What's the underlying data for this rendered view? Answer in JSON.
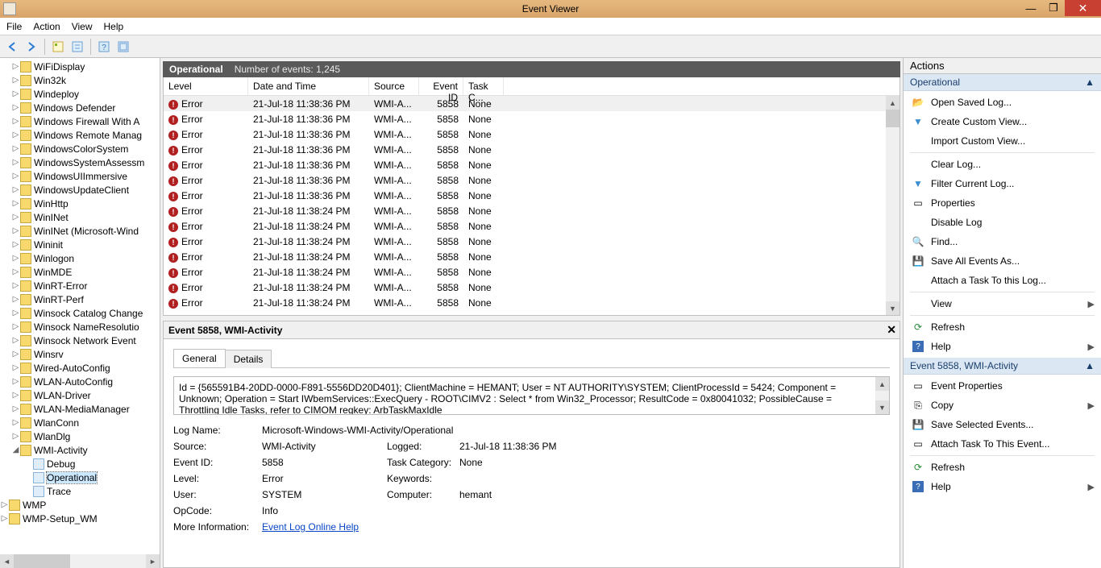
{
  "window": {
    "title": "Event Viewer"
  },
  "menu": {
    "file": "File",
    "action": "Action",
    "view": "View",
    "help": "Help"
  },
  "tree": {
    "items": [
      "WiFiDisplay",
      "Win32k",
      "Windeploy",
      "Windows Defender",
      "Windows Firewall With A",
      "Windows Remote Manag",
      "WindowsColorSystem",
      "WindowsSystemAssessm",
      "WindowsUIImmersive",
      "WindowsUpdateClient",
      "WinHttp",
      "WinINet",
      "WinINet (Microsoft-Wind",
      "Wininit",
      "Winlogon",
      "WinMDE",
      "WinRT-Error",
      "WinRT-Perf",
      "Winsock Catalog Change",
      "Winsock NameResolutio",
      "Winsock Network Event",
      "Winsrv",
      "Wired-AutoConfig",
      "WLAN-AutoConfig",
      "WLAN-Driver",
      "WLAN-MediaManager",
      "WlanConn",
      "WlanDlg"
    ],
    "wmi": {
      "label": "WMI-Activity",
      "children": [
        "Debug",
        "Operational",
        "Trace"
      ]
    },
    "after": [
      "WMP",
      "WMP-Setup_WM"
    ],
    "selected": "Operational"
  },
  "listHeader": {
    "title": "Operational",
    "count": "Number of events: 1,245"
  },
  "columns": {
    "level": "Level",
    "date": "Date and Time",
    "source": "Source",
    "eid": "Event ID",
    "task": "Task C..."
  },
  "rows": [
    {
      "level": "Error",
      "date": "21-Jul-18 11:38:36 PM",
      "source": "WMI-A...",
      "eid": "5858",
      "task": "None"
    },
    {
      "level": "Error",
      "date": "21-Jul-18 11:38:36 PM",
      "source": "WMI-A...",
      "eid": "5858",
      "task": "None"
    },
    {
      "level": "Error",
      "date": "21-Jul-18 11:38:36 PM",
      "source": "WMI-A...",
      "eid": "5858",
      "task": "None"
    },
    {
      "level": "Error",
      "date": "21-Jul-18 11:38:36 PM",
      "source": "WMI-A...",
      "eid": "5858",
      "task": "None"
    },
    {
      "level": "Error",
      "date": "21-Jul-18 11:38:36 PM",
      "source": "WMI-A...",
      "eid": "5858",
      "task": "None"
    },
    {
      "level": "Error",
      "date": "21-Jul-18 11:38:36 PM",
      "source": "WMI-A...",
      "eid": "5858",
      "task": "None"
    },
    {
      "level": "Error",
      "date": "21-Jul-18 11:38:36 PM",
      "source": "WMI-A...",
      "eid": "5858",
      "task": "None"
    },
    {
      "level": "Error",
      "date": "21-Jul-18 11:38:24 PM",
      "source": "WMI-A...",
      "eid": "5858",
      "task": "None"
    },
    {
      "level": "Error",
      "date": "21-Jul-18 11:38:24 PM",
      "source": "WMI-A...",
      "eid": "5858",
      "task": "None"
    },
    {
      "level": "Error",
      "date": "21-Jul-18 11:38:24 PM",
      "source": "WMI-A...",
      "eid": "5858",
      "task": "None"
    },
    {
      "level": "Error",
      "date": "21-Jul-18 11:38:24 PM",
      "source": "WMI-A...",
      "eid": "5858",
      "task": "None"
    },
    {
      "level": "Error",
      "date": "21-Jul-18 11:38:24 PM",
      "source": "WMI-A...",
      "eid": "5858",
      "task": "None"
    },
    {
      "level": "Error",
      "date": "21-Jul-18 11:38:24 PM",
      "source": "WMI-A...",
      "eid": "5858",
      "task": "None"
    },
    {
      "level": "Error",
      "date": "21-Jul-18 11:38:24 PM",
      "source": "WMI-A...",
      "eid": "5858",
      "task": "None"
    }
  ],
  "detail": {
    "title": "Event 5858, WMI-Activity",
    "tabs": {
      "general": "General",
      "details": "Details"
    },
    "description": "Id = {565591B4-20DD-0000-F891-5556DD20D401}; ClientMachine = HEMANT; User = NT AUTHORITY\\SYSTEM; ClientProcessId = 5424; Component = Unknown; Operation = Start IWbemServices::ExecQuery - ROOT\\CIMV2 : Select * from Win32_Processor; ResultCode = 0x80041032; PossibleCause = Throttling Idle Tasks, refer to CIMOM regkey: ArbTaskMaxIdle",
    "props": {
      "logNameLbl": "Log Name:",
      "logName": "Microsoft-Windows-WMI-Activity/Operational",
      "sourceLbl": "Source:",
      "source": "WMI-Activity",
      "loggedLbl": "Logged:",
      "logged": "21-Jul-18 11:38:36 PM",
      "eidLbl": "Event ID:",
      "eid": "5858",
      "taskLbl": "Task Category:",
      "task": "None",
      "levelLbl": "Level:",
      "level": "Error",
      "keywordsLbl": "Keywords:",
      "keywords": "",
      "userLbl": "User:",
      "user": "SYSTEM",
      "computerLbl": "Computer:",
      "computer": "hemant",
      "opcodeLbl": "OpCode:",
      "opcode": "Info",
      "moreLbl": "More Information:",
      "moreLink": "Event Log Online Help"
    }
  },
  "actions": {
    "title": "Actions",
    "sec1": "Operational",
    "items1": [
      "Open Saved Log...",
      "Create Custom View...",
      "Import Custom View...",
      "Clear Log...",
      "Filter Current Log...",
      "Properties",
      "Disable Log",
      "Find...",
      "Save All Events As...",
      "Attach a Task To this Log...",
      "View",
      "Refresh",
      "Help"
    ],
    "sec2": "Event 5858, WMI-Activity",
    "items2": [
      "Event Properties",
      "Copy",
      "Save Selected Events...",
      "Attach Task To This Event...",
      "Refresh",
      "Help"
    ]
  }
}
